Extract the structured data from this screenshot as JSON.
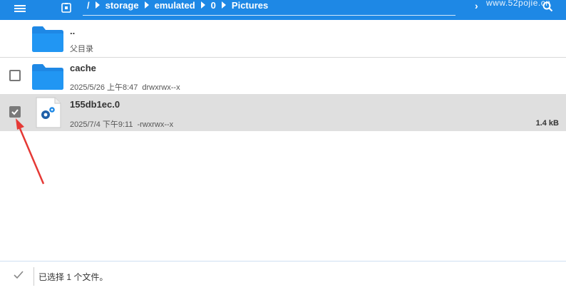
{
  "breadcrumb": {
    "root": "/",
    "segments": [
      "storage",
      "emulated",
      "0",
      "Pictures"
    ]
  },
  "watermark": "www.52pojie.cn",
  "files": [
    {
      "name": "..",
      "subtitle": "父目录"
    },
    {
      "name": "cache",
      "date": "2025/5/26 上午8:47",
      "permissions": "drwxrwx--x",
      "checked": false
    },
    {
      "name": "155db1ec.0",
      "date": "2025/7/4 下午9:11",
      "permissions": "-rwxrwx--x",
      "size": "1.4 kB",
      "checked": true
    }
  ],
  "status": {
    "text": "已选择 1 个文件。"
  },
  "colors": {
    "toolbar": "#1e88e5",
    "folder": "#1e88e5",
    "selected_row": "#dfdfdf",
    "annotation_arrow": "#e53935"
  },
  "icons": {
    "menu": "hamburger-menu-icon",
    "storage": "storage-device-icon",
    "search": "search-icon",
    "parent": "folder-icon",
    "folder": "folder-icon",
    "file": "settings-file-icon",
    "confirm": "checkmark-icon"
  }
}
